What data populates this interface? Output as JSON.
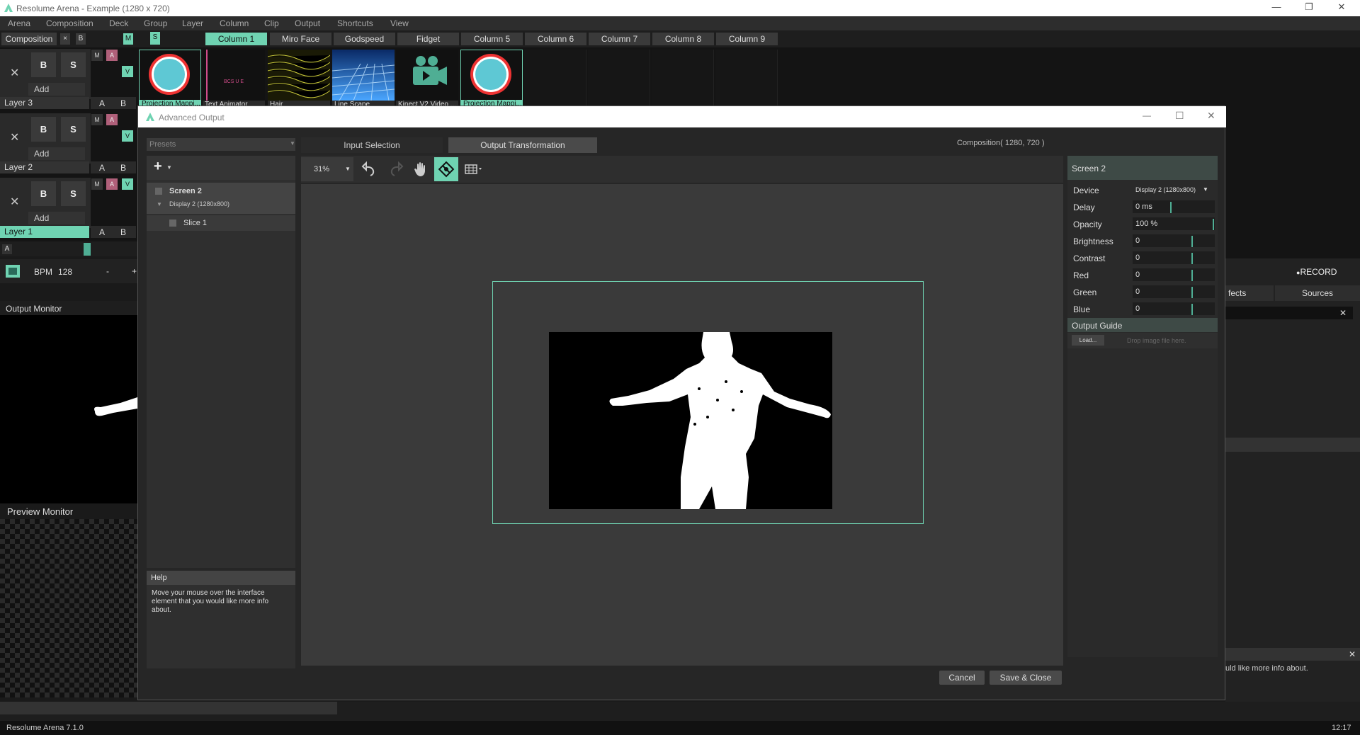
{
  "window": {
    "title": "Resolume Arena - Example (1280 x 720)"
  },
  "menu": [
    "Arena",
    "Composition",
    "Deck",
    "Group",
    "Layer",
    "Column",
    "Clip",
    "Output",
    "Shortcuts",
    "View"
  ],
  "composition": {
    "label": "Composition",
    "x": "×",
    "b": "B",
    "m": "M",
    "s": "S"
  },
  "columns": [
    "Column 1",
    "Miro Face",
    "Godspeed",
    "Fidget",
    "Column 5",
    "Column 6",
    "Column 7",
    "Column 8",
    "Column 9"
  ],
  "layers": [
    {
      "name": "Layer 3",
      "b": "B",
      "s": "S",
      "add": "Add",
      "m": "M",
      "a": "A",
      "v": "V",
      "ab_a": "A",
      "ab_b": "B"
    },
    {
      "name": "Layer 2",
      "b": "B",
      "s": "S",
      "add": "Add",
      "m": "M",
      "a": "A",
      "v": "V",
      "ab_a": "A",
      "ab_b": "B"
    },
    {
      "name": "Layer 1",
      "b": "B",
      "s": "S",
      "add": "Add",
      "m": "M",
      "a": "A",
      "v": "V",
      "ab_a": "A",
      "ab_b": "B"
    }
  ],
  "clips": [
    "Projection Mappi...",
    "Text Animator",
    "Hair",
    "Line Scape",
    "Kinect V2 Video ...",
    "Projection Mappi..."
  ],
  "text_animator_preview": "BCS   U  E",
  "crossfader": {
    "a": "A"
  },
  "bpm": {
    "label": "BPM",
    "value": "128",
    "minus": "-",
    "plus": "+"
  },
  "monitors": {
    "output": "Output Monitor",
    "preview": "Preview Monitor"
  },
  "right": {
    "record": "RECORD",
    "tabs": [
      "fects",
      "Sources"
    ],
    "help_tail": "uld like more info about.",
    "close": "✕"
  },
  "dialog": {
    "title": "Advanced Output",
    "presets": "Presets",
    "tabs": [
      "Input Selection",
      "Output Transformation"
    ],
    "composition_info": "Composition( 1280, 720 )",
    "zoom": "31%",
    "add": "+",
    "tree": {
      "screen": "Screen 2",
      "display": "Display 2 (1280x800)",
      "slice": "Slice 1"
    },
    "help": {
      "title": "Help",
      "text": "Move your mouse over the interface element that you would like more info about."
    },
    "props": {
      "title": "Screen 2",
      "rows": [
        {
          "k": "Device",
          "v": "Display 2 (1280x800)"
        },
        {
          "k": "Delay",
          "v": "0 ms"
        },
        {
          "k": "Opacity",
          "v": "100 %"
        },
        {
          "k": "Brightness",
          "v": "0"
        },
        {
          "k": "Contrast",
          "v": "0"
        },
        {
          "k": "Red",
          "v": "0"
        },
        {
          "k": "Green",
          "v": "0"
        },
        {
          "k": "Blue",
          "v": "0"
        }
      ],
      "guide": "Output Guide",
      "load": "Load...",
      "drop": "Drop image file here."
    },
    "cancel": "Cancel",
    "save": "Save & Close"
  },
  "status": {
    "left": "Resolume Arena 7.1.0",
    "right": "12:17"
  },
  "colors": {
    "accent": "#6fd3b2",
    "pink": "#b0607a",
    "bg": "#1a1a1a"
  }
}
